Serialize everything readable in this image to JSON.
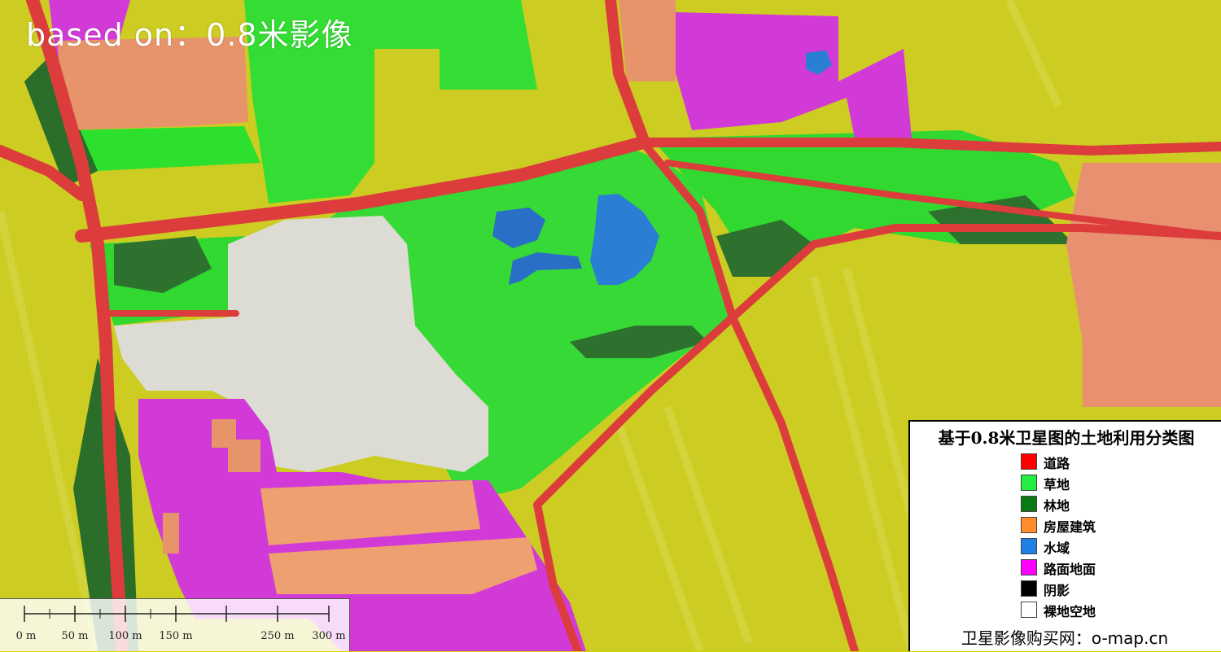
{
  "overlay_title": "based on：0.8米影像",
  "legend": {
    "title": "基于0.8米卫星图的土地利用分类图",
    "items": [
      {
        "label": "道路",
        "color": "#ff0000"
      },
      {
        "label": "草地",
        "color": "#22ee44"
      },
      {
        "label": "林地",
        "color": "#0a7a14"
      },
      {
        "label": "房屋建筑",
        "color": "#ff8c2a"
      },
      {
        "label": "水域",
        "color": "#1e7fe6"
      },
      {
        "label": "路面地面",
        "color": "#ff00ff"
      },
      {
        "label": "阴影",
        "color": "#000000"
      },
      {
        "label": "裸地空地",
        "color": "#ffffff"
      }
    ],
    "footer": "卫星影像购买网：o-map.cn"
  },
  "scalebar": {
    "labels": [
      "0 m",
      "50 m",
      "100 m",
      "150 m",
      "250 m",
      "300 m"
    ]
  },
  "map_colors": {
    "farmland": "#cfcf1e",
    "grass": "#33dd33",
    "forest": "#2a6e2a",
    "building": "#e8946a",
    "water": "#2a7fd4",
    "pavement": "#d23ad8",
    "road": "#dc3c3c",
    "bare": "#d9d9d2"
  }
}
